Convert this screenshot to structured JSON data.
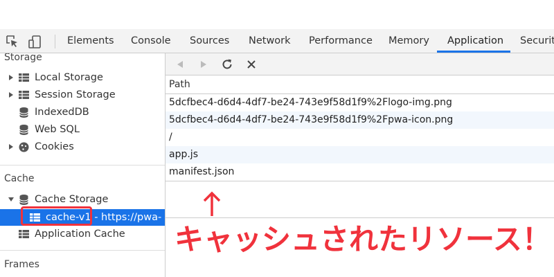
{
  "tabs": [
    {
      "label": "Elements"
    },
    {
      "label": "Console"
    },
    {
      "label": "Sources"
    },
    {
      "label": "Network"
    },
    {
      "label": "Performance"
    },
    {
      "label": "Memory"
    },
    {
      "label": "Application",
      "active": true
    },
    {
      "label": "Security"
    }
  ],
  "sidebar": {
    "storage_title": "Storage",
    "storage_items": [
      "Local Storage",
      "Session Storage",
      "IndexedDB",
      "Web SQL",
      "Cookies"
    ],
    "cache_title": "Cache",
    "cache_storage": "Cache Storage",
    "cache_entry": "cache-v1 - https://pwa-",
    "app_cache": "Application Cache",
    "frames_title": "Frames"
  },
  "table": {
    "header_path": "Path",
    "rows": [
      "5dcfbec4-d6d4-4df7-be24-743e9f58d1f9%2Flogo-img.png",
      "5dcfbec4-d6d4-4df7-be24-743e9f58d1f9%2Fpwa-icon.png",
      "/",
      "app.js",
      "manifest.json"
    ]
  },
  "annotation": {
    "text": "キャッシュされたリソース！"
  },
  "colors": {
    "accent": "#1a73e8",
    "annotation": "#f0323c"
  }
}
